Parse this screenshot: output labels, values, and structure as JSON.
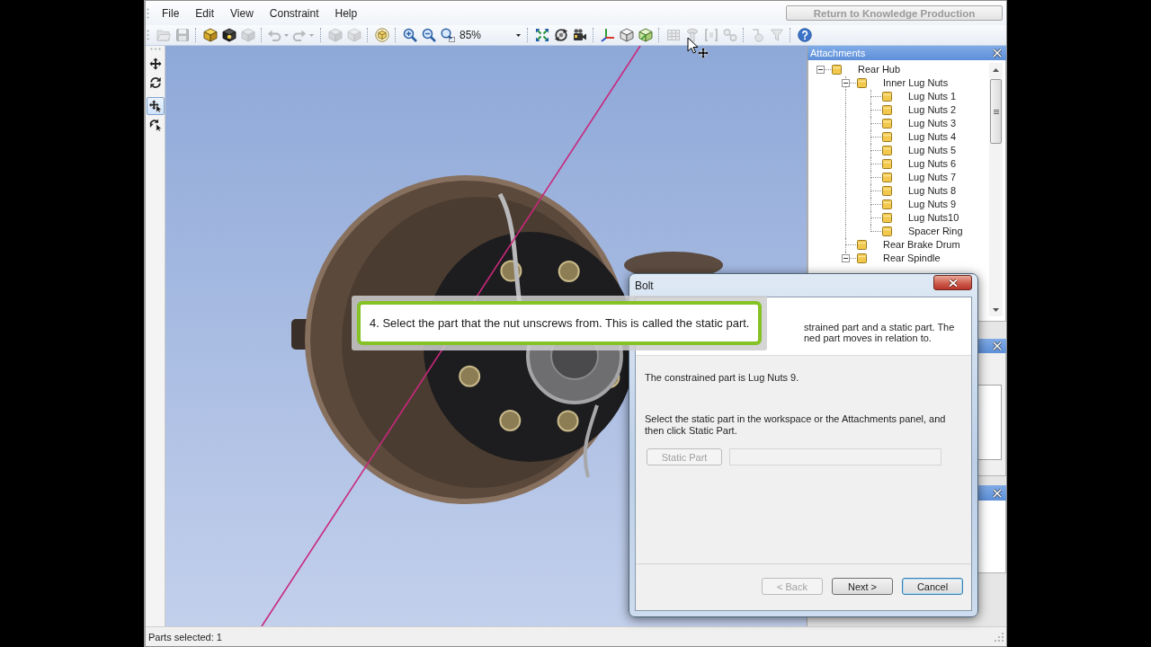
{
  "menu": [
    "File",
    "Edit",
    "View",
    "Constraint",
    "Help"
  ],
  "return_button": {
    "label": "Return to Knowledge Production",
    "disabled": true
  },
  "toolbar_groups": [
    [
      {
        "kind": "button",
        "disabled": true
      },
      {
        "kind": "button",
        "disabled": true
      }
    ],
    [
      {
        "kind": "button",
        "disabled": false
      },
      {
        "kind": "button",
        "disabled": false
      },
      {
        "kind": "button",
        "disabled": true
      }
    ],
    [
      {
        "kind": "split",
        "disabled": true
      },
      {
        "kind": "split",
        "disabled": true
      }
    ],
    [
      {
        "kind": "button",
        "disabled": true
      },
      {
        "kind": "button",
        "disabled": true
      }
    ],
    [
      {
        "kind": "button",
        "disabled": false
      }
    ],
    [
      {
        "kind": "button",
        "disabled": false
      },
      {
        "kind": "button",
        "disabled": false
      },
      {
        "kind": "button",
        "disabled": false
      },
      {
        "kind": "combo",
        "value": "85%"
      }
    ],
    [
      {
        "kind": "button",
        "disabled": false
      },
      {
        "kind": "button",
        "disabled": false
      },
      {
        "kind": "button",
        "disabled": false
      }
    ],
    [
      {
        "kind": "button",
        "disabled": false
      },
      {
        "kind": "button",
        "disabled": false
      },
      {
        "kind": "button",
        "disabled": false
      }
    ],
    [
      {
        "kind": "button",
        "disabled": true
      },
      {
        "kind": "button",
        "disabled": true
      },
      {
        "kind": "button",
        "disabled": true
      },
      {
        "kind": "button",
        "disabled": true
      }
    ],
    [
      {
        "kind": "button",
        "disabled": true
      },
      {
        "kind": "button",
        "disabled": true
      }
    ],
    [
      {
        "kind": "button",
        "disabled": false
      }
    ]
  ],
  "tools": [
    {
      "selected": false
    },
    {
      "selected": false
    },
    {
      "selected": true
    },
    {
      "selected": false
    }
  ],
  "attachments": {
    "title": "Attachments",
    "tree": [
      {
        "label": "Rear Hub",
        "expanded": true,
        "children": [
          {
            "label": "Inner Lug Nuts",
            "expanded": true,
            "children": [
              {
                "label": "Lug Nuts 1"
              },
              {
                "label": "Lug Nuts 2"
              },
              {
                "label": "Lug Nuts 3"
              },
              {
                "label": "Lug Nuts 4"
              },
              {
                "label": "Lug Nuts 5"
              },
              {
                "label": "Lug Nuts 6"
              },
              {
                "label": "Lug Nuts 7"
              },
              {
                "label": "Lug Nuts 8"
              },
              {
                "label": "Lug Nuts 9"
              },
              {
                "label": "Lug Nuts10"
              },
              {
                "label": "Spacer Ring"
              }
            ]
          },
          {
            "label": "Rear Brake Drum"
          },
          {
            "label": "Rear Spindle",
            "expanded": true
          }
        ]
      }
    ]
  },
  "callout": {
    "text": "4. Select the part that the nut unscrews from. This is called the static part."
  },
  "dialog": {
    "title": "Bolt",
    "description_fragments": [
      "strained part and a static part. The",
      "ned part moves in relation to."
    ],
    "constrained_text": "The constrained part is Lug Nuts 9.",
    "instruction": "Select the static part in the workspace or the Attachments panel, and then click Static Part.",
    "static_part_button": {
      "label": "Static Part",
      "disabled": true
    },
    "static_part_field": {
      "disabled": true
    },
    "buttons": [
      {
        "label": "< Back",
        "disabled": true,
        "focused": false
      },
      {
        "label": "Next >",
        "disabled": false,
        "focused": false
      },
      {
        "label": "Cancel",
        "disabled": false,
        "focused": true
      }
    ]
  },
  "status_bar": {
    "text": "Parts selected: 1"
  }
}
